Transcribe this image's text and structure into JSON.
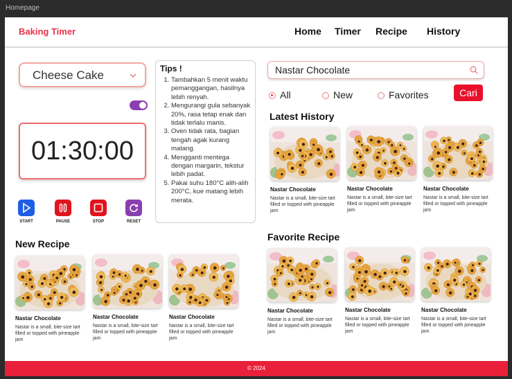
{
  "window": {
    "tab_title": "Homepage"
  },
  "header": {
    "brand": "Baking Timer",
    "nav": [
      "Home",
      "Timer",
      "Recipe",
      "History"
    ]
  },
  "timer_panel": {
    "selected_recipe": "Cheese Cake",
    "time": "01:30:00",
    "controls": [
      "START",
      "PAUSE",
      "STOP",
      "RESET"
    ]
  },
  "tips": {
    "title": "Tips !",
    "items": [
      "Tambahkan 5 menit waktu pemanggangan, hasilnya lebih renyah.",
      "Mengurangi gula sebanyak 20%, rasa tetap enak dan tidak terlalu manis.",
      "Oven tidak rata, bagian tengah agak kurang matang.",
      "Mengganti mentega dengan margarin, tekstur lebih padat.",
      "Pakai suhu 180°C alih-alih 200°C, kue matang lebih merata."
    ]
  },
  "search": {
    "value": "Nastar Chocolate",
    "filters": [
      "All",
      "New",
      "Favorites"
    ],
    "selected_filter": "All",
    "button": "Cari"
  },
  "sections": {
    "latest_history": "Latest History",
    "new_recipe": "New Recipe",
    "favorite_recipe": "Favorite Recipe"
  },
  "card": {
    "name": "Nastar Chocolate",
    "desc": "Nastar is a small, bite-size tart filled or topped with pineapple jam"
  },
  "footer": "© 2024",
  "colors": {
    "accent": "#e8203a",
    "start": "#1e5de6",
    "pause": "#e0141d",
    "stop": "#e0141d",
    "reset": "#8a3fb0"
  }
}
